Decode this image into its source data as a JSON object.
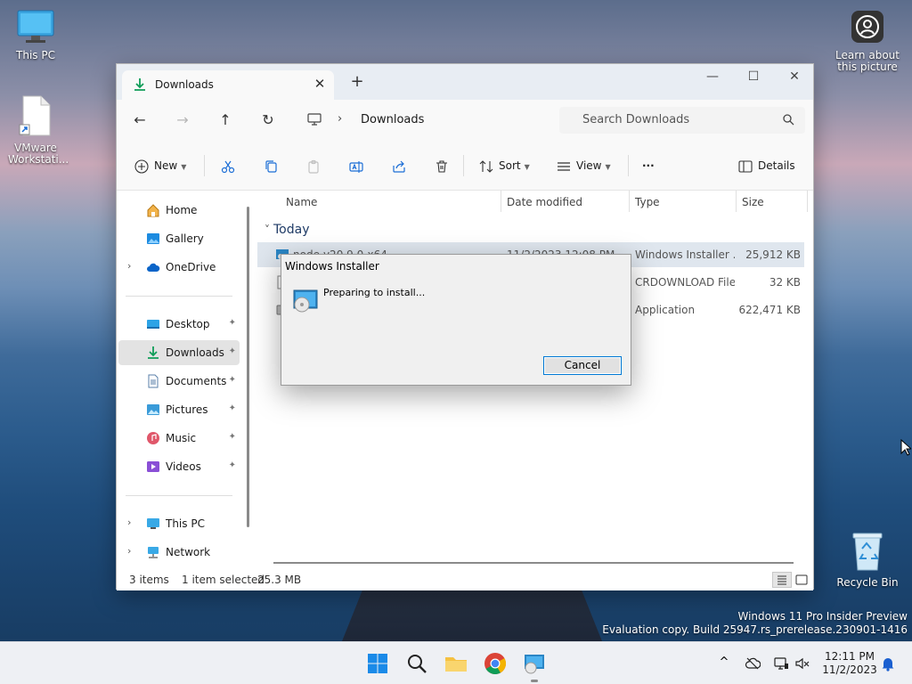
{
  "desktop": {
    "icons": [
      {
        "label": "This PC"
      },
      {
        "label": "VMware Workstati..."
      },
      {
        "label": "Learn about this picture"
      },
      {
        "label": "Recycle Bin"
      }
    ],
    "watermark_line1": "Windows 11 Pro Insider Preview",
    "watermark_line2": "Evaluation copy. Build 25947.rs_prerelease.230901-1416"
  },
  "explorer": {
    "tab_label": "Downloads",
    "tab_close": "✕",
    "new_tab": "+",
    "window_buttons": {
      "minimize": "—",
      "maximize": "☐",
      "close": "✕"
    },
    "breadcrumb": {
      "separator": "›",
      "current": "Downloads"
    },
    "search_placeholder": "Search Downloads",
    "toolbar": {
      "new_label": "New",
      "sort_label": "Sort",
      "view_label": "View",
      "more_label": "···",
      "details_label": "Details"
    },
    "sidebar": {
      "items": [
        {
          "label": "Home",
          "icon": "home-icon"
        },
        {
          "label": "Gallery",
          "icon": "gallery-icon"
        },
        {
          "label": "OneDrive",
          "icon": "cloud-icon"
        },
        {
          "label": "Desktop",
          "icon": "desktop-icon"
        },
        {
          "label": "Downloads",
          "icon": "download-icon"
        },
        {
          "label": "Documents",
          "icon": "documents-icon"
        },
        {
          "label": "Pictures",
          "icon": "pictures-icon"
        },
        {
          "label": "Music",
          "icon": "music-icon"
        },
        {
          "label": "Videos",
          "icon": "videos-icon"
        },
        {
          "label": "This PC",
          "icon": "computer-icon"
        },
        {
          "label": "Network",
          "icon": "network-icon"
        }
      ],
      "expand": "›",
      "pin": "📌"
    },
    "columns": {
      "name": "Name",
      "date": "Date modified",
      "type": "Type",
      "size": "Size"
    },
    "group": {
      "chevron": "˅",
      "label": "Today"
    },
    "files": [
      {
        "name": "node-v20.9.0-x64",
        "date": "11/2/2023 12:08 PM",
        "type": "Windows Installer ...",
        "size": "25,912 KB"
      },
      {
        "name": "",
        "date": "",
        "type": "CRDOWNLOAD File",
        "size": "32 KB"
      },
      {
        "name": "",
        "date": "",
        "type": "Application",
        "size": "622,471 KB"
      }
    ],
    "status": {
      "items": "3 items",
      "selected": "1 item selected",
      "size": "25.3 MB"
    }
  },
  "installer": {
    "title": "Windows Installer",
    "message": "Preparing to install...",
    "cancel_label": "Cancel"
  },
  "taskbar": {
    "time": "12:11 PM",
    "date": "11/2/2023",
    "tray_chevron": "^"
  }
}
